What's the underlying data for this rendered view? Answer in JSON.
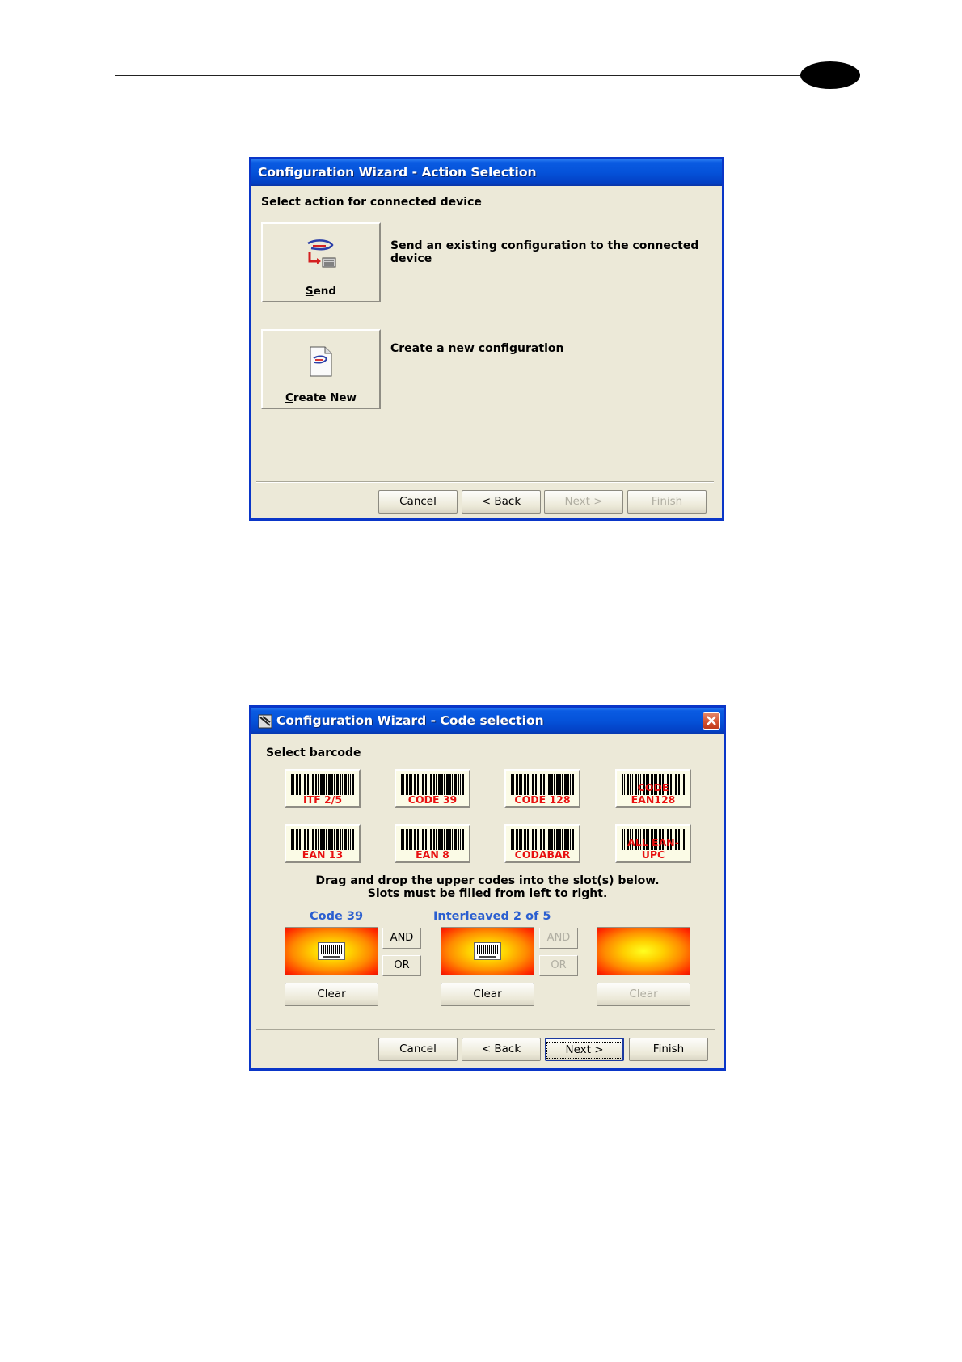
{
  "page": {},
  "window1": {
    "title": "Configuration Wizard - Action Selection",
    "prompt": "Select action for connected device",
    "actions": [
      {
        "label": "Send",
        "mnemonic": "S",
        "rest": "end",
        "description": "Send an existing configuration to the connected device",
        "icon": "send-config-icon"
      },
      {
        "label": "Create New",
        "mnemonic": "C",
        "rest": "reate New",
        "description": "Create a new configuration",
        "icon": "new-document-icon"
      }
    ],
    "buttons": {
      "cancel": "Cancel",
      "back": "< Back",
      "next": "Next >",
      "finish": "Finish"
    }
  },
  "window2": {
    "title": "Configuration Wizard - Code selection",
    "prompt": "Select barcode",
    "barcodes": [
      "ITF 2/5",
      "CODE 39",
      "CODE 128",
      "CODE EAN128",
      "EAN 13",
      "EAN 8",
      "CODABAR",
      "ALL EAN-UPC"
    ],
    "instructions": [
      "Drag and drop the upper codes into the slot(s) below.",
      "Slots must be filled from left to right."
    ],
    "slots": [
      {
        "label": "Code 39",
        "filled": true
      },
      {
        "label": "Interleaved 2  of 5",
        "filled": true
      },
      {
        "label": "",
        "filled": false
      }
    ],
    "logic": [
      {
        "and": "AND",
        "or": "OR",
        "enabled": true
      },
      {
        "and": "AND",
        "or": "OR",
        "enabled": false
      }
    ],
    "clear_label": "Clear",
    "buttons": {
      "cancel": "Cancel",
      "back": "< Back",
      "next": "Next >",
      "finish": "Finish"
    },
    "colors": {
      "slot_label": "#2b5fd0",
      "barcode_text": "#e81010"
    }
  }
}
